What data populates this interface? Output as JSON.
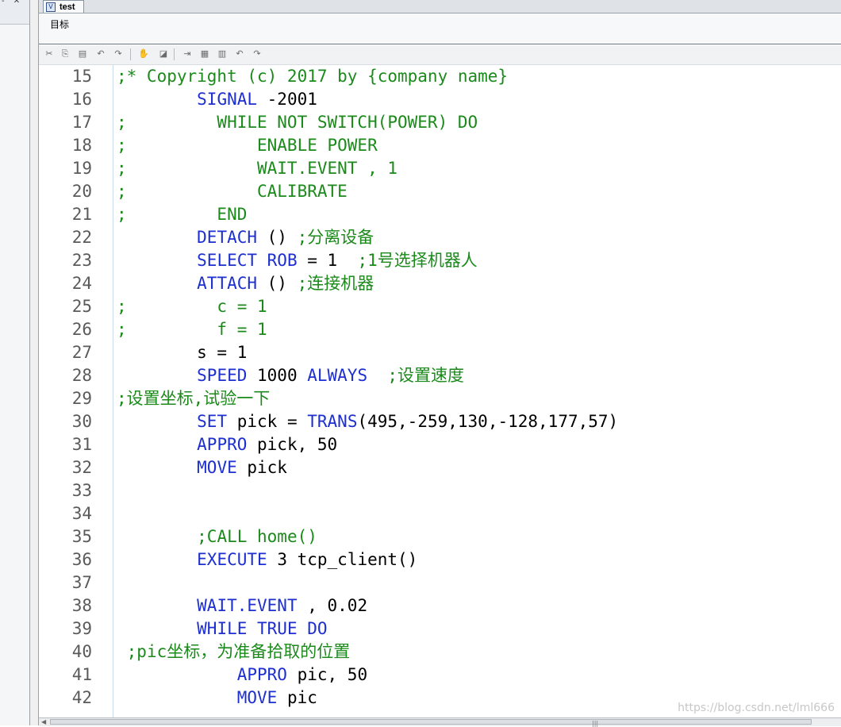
{
  "left_panel": {
    "fragment": "- ✕"
  },
  "tab": {
    "label": "test",
    "icon": "V"
  },
  "target_bar": {
    "label": "目标"
  },
  "toolbar": {
    "buttons": [
      {
        "name": "cut-icon",
        "glyph": "✂"
      },
      {
        "name": "copy-icon",
        "glyph": "⎘"
      },
      {
        "name": "paste-icon",
        "glyph": "▤"
      },
      {
        "name": "undo-icon",
        "glyph": "↶"
      },
      {
        "name": "redo-icon",
        "glyph": "↷"
      },
      {
        "name": "hand-icon",
        "glyph": "✋"
      },
      {
        "name": "eraser-icon",
        "glyph": "◪"
      },
      {
        "name": "indent-icon",
        "glyph": "⇥"
      },
      {
        "name": "call-icon",
        "glyph": "▦"
      },
      {
        "name": "block-icon",
        "glyph": "▥"
      },
      {
        "name": "undo2-icon",
        "glyph": "↶"
      },
      {
        "name": "redo2-icon",
        "glyph": "↷"
      }
    ]
  },
  "code_lines": [
    {
      "n": "15",
      "segs": [
        {
          "c": "cm",
          "t": ";* Copyright (c) 2017 by {company name}"
        }
      ]
    },
    {
      "n": "16",
      "segs": [
        {
          "c": "tx",
          "t": "        "
        },
        {
          "c": "kw",
          "t": "SIGNAL"
        },
        {
          "c": "tx",
          "t": " -2001"
        }
      ]
    },
    {
      "n": "17",
      "segs": [
        {
          "c": "cm",
          "t": ";         WHILE NOT SWITCH(POWER) DO"
        }
      ]
    },
    {
      "n": "18",
      "segs": [
        {
          "c": "cm",
          "t": ";             ENABLE POWER"
        }
      ]
    },
    {
      "n": "19",
      "segs": [
        {
          "c": "cm",
          "t": ";             WAIT.EVENT , 1"
        }
      ]
    },
    {
      "n": "20",
      "segs": [
        {
          "c": "cm",
          "t": ";             CALIBRATE"
        }
      ]
    },
    {
      "n": "21",
      "segs": [
        {
          "c": "cm",
          "t": ";         END"
        }
      ]
    },
    {
      "n": "22",
      "segs": [
        {
          "c": "tx",
          "t": "        "
        },
        {
          "c": "kw",
          "t": "DETACH"
        },
        {
          "c": "tx",
          "t": " () "
        },
        {
          "c": "cm",
          "t": ";分离设备"
        }
      ]
    },
    {
      "n": "23",
      "segs": [
        {
          "c": "tx",
          "t": "        "
        },
        {
          "c": "kw",
          "t": "SELECT ROB"
        },
        {
          "c": "tx",
          "t": " = 1  "
        },
        {
          "c": "cm",
          "t": ";1号选择机器人"
        }
      ]
    },
    {
      "n": "24",
      "segs": [
        {
          "c": "tx",
          "t": "        "
        },
        {
          "c": "kw",
          "t": "ATTACH"
        },
        {
          "c": "tx",
          "t": " () "
        },
        {
          "c": "cm",
          "t": ";连接机器"
        }
      ]
    },
    {
      "n": "25",
      "segs": [
        {
          "c": "cm",
          "t": ";         c = 1"
        }
      ]
    },
    {
      "n": "26",
      "segs": [
        {
          "c": "cm",
          "t": ";         f = 1"
        }
      ]
    },
    {
      "n": "27",
      "segs": [
        {
          "c": "tx",
          "t": "        s = 1"
        }
      ]
    },
    {
      "n": "28",
      "segs": [
        {
          "c": "tx",
          "t": "        "
        },
        {
          "c": "kw",
          "t": "SPEED"
        },
        {
          "c": "tx",
          "t": " 1000 "
        },
        {
          "c": "kw",
          "t": "ALWAYS"
        },
        {
          "c": "tx",
          "t": "  "
        },
        {
          "c": "cm",
          "t": ";设置速度"
        }
      ]
    },
    {
      "n": "29",
      "segs": [
        {
          "c": "cm",
          "t": ";设置坐标,试验一下"
        }
      ]
    },
    {
      "n": "30",
      "segs": [
        {
          "c": "tx",
          "t": "        "
        },
        {
          "c": "kw",
          "t": "SET"
        },
        {
          "c": "tx",
          "t": " pick = "
        },
        {
          "c": "kw",
          "t": "TRANS"
        },
        {
          "c": "tx",
          "t": "(495,-259,130,-128,177,57)"
        }
      ]
    },
    {
      "n": "31",
      "segs": [
        {
          "c": "tx",
          "t": "        "
        },
        {
          "c": "kw",
          "t": "APPRO"
        },
        {
          "c": "tx",
          "t": " pick, 50"
        }
      ]
    },
    {
      "n": "32",
      "segs": [
        {
          "c": "tx",
          "t": "        "
        },
        {
          "c": "kw",
          "t": "MOVE"
        },
        {
          "c": "tx",
          "t": " pick"
        }
      ]
    },
    {
      "n": "33",
      "segs": []
    },
    {
      "n": "34",
      "segs": []
    },
    {
      "n": "35",
      "segs": [
        {
          "c": "tx",
          "t": "        "
        },
        {
          "c": "cm",
          "t": ";CALL home()"
        }
      ]
    },
    {
      "n": "36",
      "segs": [
        {
          "c": "tx",
          "t": "        "
        },
        {
          "c": "kw",
          "t": "EXECUTE"
        },
        {
          "c": "tx",
          "t": " 3 tcp_client()"
        }
      ]
    },
    {
      "n": "37",
      "segs": []
    },
    {
      "n": "38",
      "segs": [
        {
          "c": "tx",
          "t": "        "
        },
        {
          "c": "kw",
          "t": "WAIT.EVENT"
        },
        {
          "c": "tx",
          "t": " , 0.02"
        }
      ]
    },
    {
      "n": "39",
      "segs": [
        {
          "c": "tx",
          "t": "        "
        },
        {
          "c": "kw",
          "t": "WHILE TRUE DO"
        }
      ]
    },
    {
      "n": "40",
      "segs": [
        {
          "c": "tx",
          "t": " "
        },
        {
          "c": "cm",
          "t": ";pic坐标，为准备拾取的位置"
        }
      ]
    },
    {
      "n": "41",
      "segs": [
        {
          "c": "tx",
          "t": "            "
        },
        {
          "c": "kw",
          "t": "APPRO"
        },
        {
          "c": "tx",
          "t": " pic, 50"
        }
      ]
    },
    {
      "n": "42",
      "segs": [
        {
          "c": "tx",
          "t": "            "
        },
        {
          "c": "kw",
          "t": "MOVE"
        },
        {
          "c": "tx",
          "t": " pic"
        }
      ]
    }
  ],
  "watermark": "https://blog.csdn.net/lml666",
  "scrollbar": {
    "grip": "|||"
  }
}
